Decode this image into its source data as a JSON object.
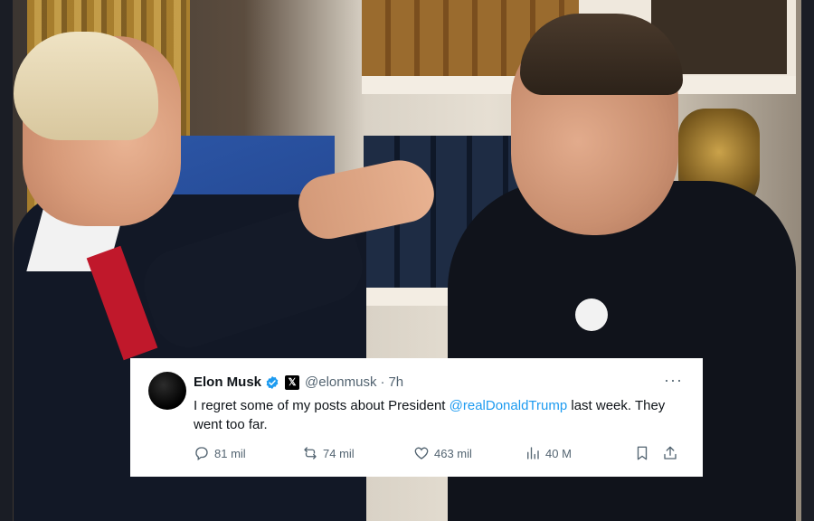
{
  "tweet": {
    "display_name": "Elon Musk",
    "handle": "@elonmusk",
    "separator": "·",
    "time": "7h",
    "more_label": "···",
    "text_before": "I regret some of my posts about President ",
    "mention": "@realDonaldTrump",
    "text_after": " last week. They went too far.",
    "metrics": {
      "replies": "81 mil",
      "reposts": "74 mil",
      "likes": "463 mil",
      "views": "40 M"
    },
    "icons": {
      "verified": "verified-badge-icon",
      "affiliation": "x-logo-icon",
      "reply": "reply-icon",
      "repost": "repost-icon",
      "like": "heart-icon",
      "views": "views-icon",
      "bookmark": "bookmark-icon",
      "share": "share-icon"
    },
    "colors": {
      "accent": "#1d9bf0",
      "text": "#0f1419",
      "muted": "#536471",
      "card": "#ffffff"
    }
  },
  "x_badge_glyph": "𝕏"
}
